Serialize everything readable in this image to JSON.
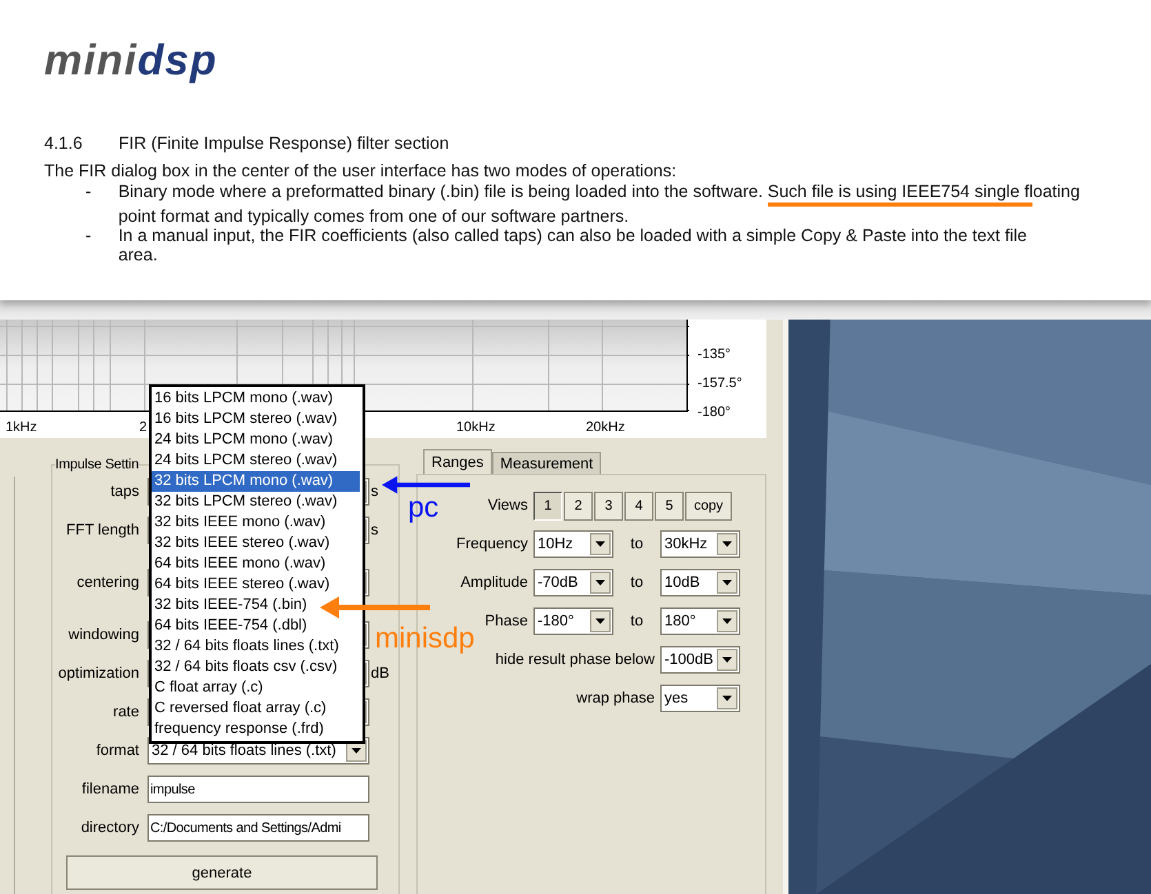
{
  "document": {
    "logo": {
      "part_1": "mini",
      "part_2": "dsp"
    },
    "section_number": "4.1.6",
    "section_title": "FIR (Finite Impulse Response) filter section",
    "intro": "The FIR dialog box in the center of the user interface has two modes of operations:",
    "bullets": [
      {
        "marker": "-",
        "lines": [
          {
            "text": "Binary mode where a preformatted binary (.bin) file is being loaded into the software. Such file is using IEEE754 single floating",
            "underlined": true
          },
          {
            "text": "point format and typically comes from one of our software partners.",
            "underlined": false
          }
        ]
      },
      {
        "marker": "-",
        "lines": [
          {
            "text": "In a manual input, the FIR coefficients (also called taps) can also be loaded with a simple Copy & Paste into the text file",
            "underlined": false
          },
          {
            "text": "area.",
            "underlined": false
          }
        ]
      }
    ]
  },
  "chart": {
    "x_ticks": [
      "1kHz",
      "2",
      "10kHz",
      "20kHz"
    ],
    "y_ticks": [
      "-135°",
      "-157.5°",
      "-180°"
    ]
  },
  "impulse_settings": {
    "title": "Impulse Settin",
    "rows": [
      {
        "label": "taps",
        "kind": "select",
        "unit": "s"
      },
      {
        "label": "FFT length",
        "kind": "select",
        "unit": "s"
      },
      {
        "label": "centering",
        "kind": "select"
      },
      {
        "label": "windowing",
        "kind": "select"
      },
      {
        "label": "optimization",
        "kind": "select",
        "unit": "dB"
      },
      {
        "label": "rate",
        "kind": "select"
      },
      {
        "label": "format",
        "kind": "select",
        "value": "32 / 64 bits floats lines (.txt)"
      },
      {
        "label": "filename",
        "kind": "field",
        "value": "impulse"
      },
      {
        "label": "directory",
        "kind": "field",
        "value": "C:/Documents and Settings/Admi"
      }
    ],
    "generate": "generate"
  },
  "format_dropdown": [
    {
      "label": "16 bits LPCM mono (.wav)",
      "selected": false
    },
    {
      "label": "16 bits LPCM stereo (.wav)",
      "selected": false
    },
    {
      "label": "24 bits LPCM mono (.wav)",
      "selected": false
    },
    {
      "label": "24 bits LPCM stereo (.wav)",
      "selected": false
    },
    {
      "label": "32 bits LPCM mono (.wav)",
      "selected": true
    },
    {
      "label": "32 bits LPCM stereo (.wav)",
      "selected": false
    },
    {
      "label": "32 bits IEEE mono (.wav)",
      "selected": false
    },
    {
      "label": "32 bits IEEE stereo (.wav)",
      "selected": false
    },
    {
      "label": "64 bits IEEE mono (.wav)",
      "selected": false
    },
    {
      "label": "64 bits IEEE stereo (.wav)",
      "selected": false
    },
    {
      "label": "32 bits IEEE-754 (.bin)",
      "selected": false
    },
    {
      "label": "64 bits IEEE-754 (.dbl)",
      "selected": false
    },
    {
      "label": "32 / 64 bits floats lines (.txt)",
      "selected": false
    },
    {
      "label": "32 / 64 bits floats csv (.csv)",
      "selected": false
    },
    {
      "label": "C float array (.c)",
      "selected": false
    },
    {
      "label": "C reversed float array (.c)",
      "selected": false
    },
    {
      "label": "frequency response (.frd)",
      "selected": false
    }
  ],
  "tabs": [
    {
      "label": "Ranges",
      "selected": true
    },
    {
      "label": "Measurement",
      "selected": false
    }
  ],
  "views": {
    "label": "Views",
    "buttons": [
      {
        "label": "1",
        "selected": true
      },
      {
        "label": "2",
        "selected": false
      },
      {
        "label": "3",
        "selected": false
      },
      {
        "label": "4",
        "selected": false
      },
      {
        "label": "5",
        "selected": false
      },
      {
        "label": "copy",
        "selected": false
      }
    ]
  },
  "ranges": [
    {
      "label": "Frequency",
      "from": "10Hz",
      "to_label": "to",
      "to": "30kHz"
    },
    {
      "label": "Amplitude",
      "from": "-70dB",
      "to_label": "to",
      "to": "10dB"
    },
    {
      "label": "Phase",
      "from": "-180°",
      "to_label": "to",
      "to": "180°"
    }
  ],
  "options": [
    {
      "label": "hide result phase below",
      "value": "-100dB"
    },
    {
      "label": "wrap phase",
      "value": "yes"
    }
  ],
  "annotations": [
    {
      "label": "pc",
      "color": "#0a14f0"
    },
    {
      "label": "minisdp",
      "color": "#ff7f0e"
    }
  ]
}
